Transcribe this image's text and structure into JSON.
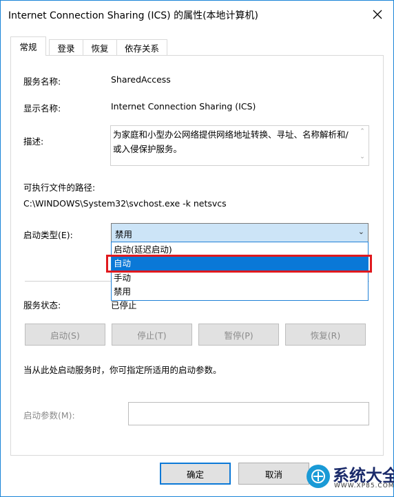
{
  "window": {
    "title": "Internet Connection Sharing (ICS) 的属性(本地计算机)"
  },
  "tabs": [
    "常规",
    "登录",
    "恢复",
    "依存关系"
  ],
  "general": {
    "service_name_label": "服务名称:",
    "service_name_value": "SharedAccess",
    "display_name_label": "显示名称:",
    "display_name_value": "Internet Connection Sharing (ICS)",
    "description_label": "描述:",
    "description_value": "为家庭和小型办公网络提供网络地址转换、寻址、名称解析和/或入侵保护服务。",
    "path_label": "可执行文件的路径:",
    "path_value": "C:\\WINDOWS\\System32\\svchost.exe -k netsvcs",
    "startup_type_label": "启动类型(E):",
    "startup_type_value": "禁用",
    "startup_options": [
      "启动(延迟启动)",
      "自动",
      "手动",
      "禁用"
    ],
    "startup_selected_index": 1,
    "service_status_label": "服务状态:",
    "service_status_value": "已停止",
    "buttons": {
      "start": "启动(S)",
      "stop": "停止(T)",
      "pause": "暂停(P)",
      "resume": "恢复(R)"
    },
    "hint_text": "当从此处启动服务时，你可指定所适用的启动参数。",
    "start_params_label": "启动参数(M):",
    "start_params_value": ""
  },
  "footer": {
    "ok": "确定",
    "cancel": "取消"
  },
  "watermark": {
    "text": "系统大全",
    "url": "WWW.XP85.COM"
  },
  "colors": {
    "accent": "#0a78d7",
    "highlight_box": "#e0191e",
    "combo_bg": "#cce4f7"
  }
}
